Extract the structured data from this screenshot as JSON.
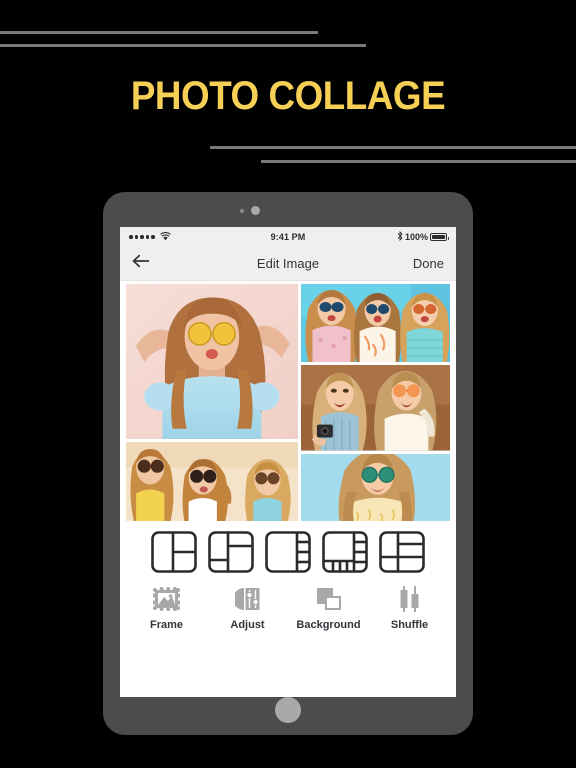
{
  "poster": {
    "title": "PHOTO COLLAGE",
    "title_color": "#f6d055",
    "background_color": "#000000",
    "rule_color": "#7a7a7a"
  },
  "device": {
    "frame_color": "#4c4c4c",
    "home_button": "home-button",
    "camera": "front-camera"
  },
  "status_bar": {
    "signal_dots": 5,
    "wifi": "wifi-icon",
    "time": "9:41 PM",
    "bluetooth": "bluetooth-icon",
    "battery_percent": "100%",
    "battery": "battery-full-icon"
  },
  "nav_bar": {
    "back": "back-arrow-icon",
    "title": "Edit Image",
    "done_label": "Done"
  },
  "collage": {
    "cells": [
      {
        "id": "photo-1",
        "description": "Woman in blue off-shoulder top with yellow sunglasses",
        "background": "#f6dcd6"
      },
      {
        "id": "photo-2",
        "description": "Three women in summer outfits on blue background",
        "background": "#63cbe2"
      },
      {
        "id": "photo-3",
        "description": "Two women laughing with camera on brown background",
        "background": "#96653f"
      },
      {
        "id": "photo-4",
        "description": "Three women with sunglasses on cream background",
        "background": "#f3e2c7"
      },
      {
        "id": "photo-5",
        "description": "Woman with round green sunglasses on light blue background",
        "background": "#a5dcea"
      }
    ]
  },
  "templates": {
    "items": [
      {
        "id": "layout-1",
        "name": "layout-2-left-2-right"
      },
      {
        "id": "layout-2",
        "name": "layout-left-split-right-split"
      },
      {
        "id": "layout-3",
        "name": "layout-large-left-4-right"
      },
      {
        "id": "layout-4",
        "name": "layout-main-right-col-bottom-strip"
      },
      {
        "id": "layout-5",
        "name": "layout-2-left-3-right"
      }
    ]
  },
  "toolbar": {
    "items": [
      {
        "id": "frame",
        "label": "Frame",
        "icon": "frame-icon"
      },
      {
        "id": "adjust",
        "label": "Adjust",
        "icon": "sliders-icon"
      },
      {
        "id": "background",
        "label": "Background",
        "icon": "layers-icon"
      },
      {
        "id": "shuffle",
        "label": "Shuffle",
        "icon": "shuffle-icon"
      }
    ]
  }
}
